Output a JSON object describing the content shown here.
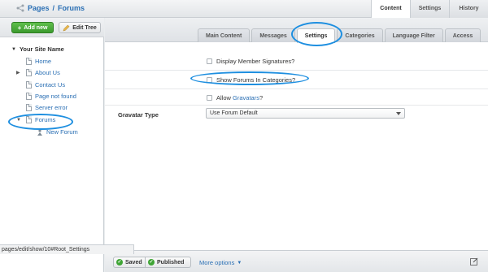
{
  "header": {
    "breadcrumb_pages": "Pages",
    "breadcrumb_sep": "/",
    "breadcrumb_current": "Forums",
    "tabs": [
      {
        "label": "Content"
      },
      {
        "label": "Settings"
      },
      {
        "label": "History"
      }
    ]
  },
  "sidebar": {
    "add_new_label": "Add new",
    "edit_tree_label": "Edit Tree",
    "site_name": "Your Site Name",
    "items": [
      {
        "label": "Home"
      },
      {
        "label": "About Us"
      },
      {
        "label": "Contact Us"
      },
      {
        "label": "Page not found"
      },
      {
        "label": "Server error"
      },
      {
        "label": "Forums"
      },
      {
        "label": "New Forum"
      }
    ]
  },
  "status_url": "pages/edit/show/10#Root_Settings",
  "main": {
    "tabs": [
      {
        "label": "Main Content"
      },
      {
        "label": "Messages"
      },
      {
        "label": "Settings"
      },
      {
        "label": "Categories"
      },
      {
        "label": "Language Filter"
      },
      {
        "label": "Access"
      }
    ],
    "checkboxes": [
      {
        "label": "Display Member Signatures?"
      },
      {
        "label": "Show Forums In Categories?"
      }
    ],
    "allow_prefix": "Allow",
    "allow_link": "Gravatars",
    "allow_suffix": "?",
    "gravatar_label": "Gravatar Type",
    "gravatar_value": "Use Forum Default"
  },
  "bottom": {
    "saved_label": "Saved",
    "published_label": "Published",
    "more_options_label": "More options"
  },
  "colors": {
    "accent": "#1e8fe0",
    "link": "#2a6fb4",
    "success": "#3fa535"
  }
}
